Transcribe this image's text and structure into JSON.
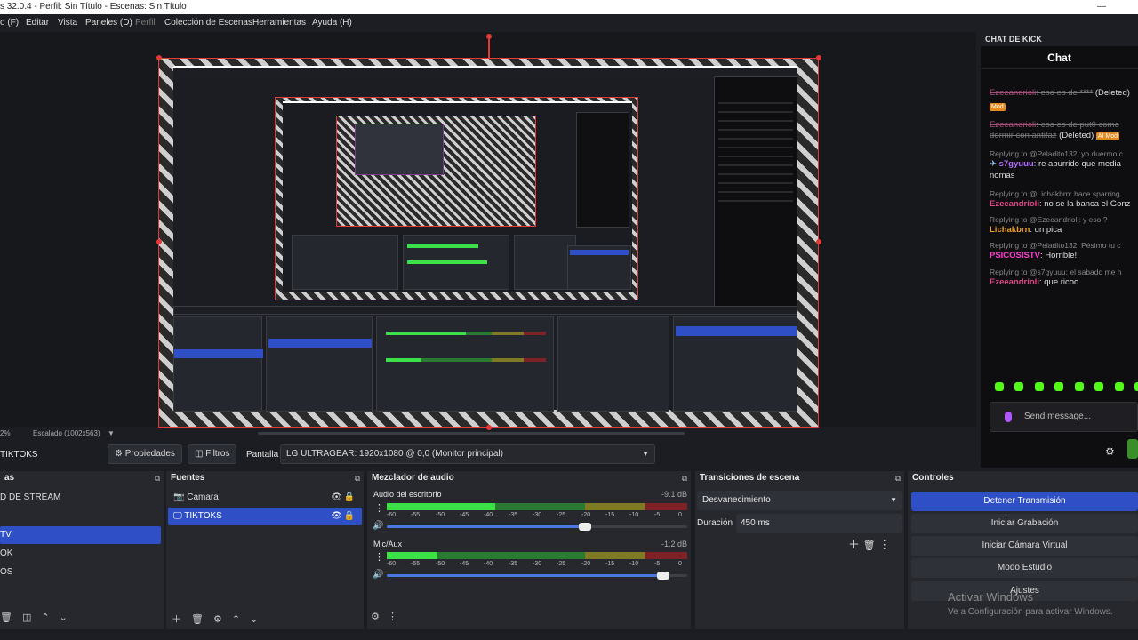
{
  "window": {
    "title": "s 32.0.4 - Perfil: Sin Título - Escenas: Sin Título"
  },
  "menu": [
    "o (F)",
    "Editar",
    "Vista",
    "Paneles (D)",
    "Perfil",
    "Colección de Escenas",
    "Herramientas",
    "Ayuda (H)"
  ],
  "chat": {
    "header": "CHAT DE KICK",
    "title": "Chat",
    "messages": [
      {
        "user": "Ezeeandrioli",
        "text": ": eso es de ****",
        "tag": "(Deleted)",
        "badge": "Mod"
      },
      {
        "user": "Ezeeandrioli",
        "text": ": eso es de put0 como",
        "text2": "dormir con antifaz",
        "tag": "(Deleted)",
        "badge": "AI Mod"
      },
      {
        "reply": "Replying to @Peladito132: yo duermo c",
        "user": "s7gyuuu",
        "text": ": re aburrido que media",
        "text2": "nomas"
      },
      {
        "reply": "Replying to @Lichakbrn: hace sparring",
        "user": "Ezeeandrioli",
        "text": ": no se la banca el Gonz"
      },
      {
        "reply": "Replying to @Ezeeandrioli: y eso ?",
        "user": "Lichakbrn",
        "text": ": un pica"
      },
      {
        "reply": "Replying to @Peladito132: Pésimo tu c",
        "user": "PSICOSISTV",
        "text": ": Horrible!"
      },
      {
        "reply": "Replying to @s7gyuuu: el sabado me h",
        "user": "Ezeeandrioli",
        "text": ": que ricoo"
      }
    ],
    "send_placeholder": "Send message..."
  },
  "preview": {
    "scale_label": "Escalado (1002x563)",
    "zoom": "2%"
  },
  "toolbar": {
    "current_source": "TIKTOKS",
    "properties": "Propiedades",
    "filters": "Filtros",
    "display_label": "Pantalla",
    "display_value": "LG ULTRAGEAR: 1920x1080 @ 0,0 (Monitor principal)"
  },
  "scenes": {
    "title": "as",
    "items": [
      "D DE STREAM",
      "",
      "TV",
      "OK",
      "OS"
    ],
    "selected": 2
  },
  "sources": {
    "title": "Fuentes",
    "items": [
      {
        "name": "Camara",
        "icon": "camera-icon"
      },
      {
        "name": "TIKTOKS",
        "icon": "monitor-icon"
      }
    ],
    "selected": 1
  },
  "mixer": {
    "title": "Mezclador de audio",
    "channels": [
      {
        "name": "Audio del escritorio",
        "db": "-9.1 dB",
        "level": 0.36,
        "volume": 0.66
      },
      {
        "name": "Mic/Aux",
        "db": "-1.2 dB",
        "level": 0.17,
        "volume": 0.92
      }
    ],
    "ticks": [
      "-60",
      "-55",
      "-50",
      "-45",
      "-40",
      "-35",
      "-30",
      "-25",
      "-20",
      "-15",
      "-10",
      "-5",
      "0"
    ]
  },
  "transitions": {
    "title": "Transiciones de escena",
    "selected": "Desvanecimiento",
    "duration_label": "Duración",
    "duration_value": "450 ms"
  },
  "controls": {
    "title": "Controles",
    "buttons": [
      "Detener Transmisión",
      "Iniciar Grabación",
      "Iniciar Cámara Virtual",
      "Modo Estudio",
      "Ajustes"
    ]
  },
  "watermark": {
    "line1": "Activar Windows",
    "line2": "Ve a Configuración para activar Windows."
  },
  "colors": {
    "accent": "#2e4fc5",
    "kick_green": "#53fc18",
    "selection_red": "#e53935"
  }
}
